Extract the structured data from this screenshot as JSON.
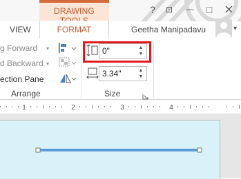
{
  "titlebar": {
    "contextual_tab": "DRAWING TOOLS",
    "help_glyph": "?",
    "restore_glyph": "⊡",
    "minimize_glyph": "—",
    "maximize_glyph": "□"
  },
  "tabs": {
    "view": "VIEW",
    "format": "FORMAT",
    "user_name": "Geetha Manipadavu",
    "account_dropdown": "▾"
  },
  "arrange": {
    "bring_forward": "g Forward",
    "send_backward": "d Backward",
    "selection_pane": "ection Pane",
    "group_label": "Arrange",
    "dropdown_caret": "▾"
  },
  "size": {
    "height_value": "0\"",
    "width_value": "3.34\"",
    "group_label": "Size",
    "up_glyph": "▲",
    "down_glyph": "▼"
  },
  "ruler": {
    "ticks": [
      "1",
      "2",
      "3",
      "4"
    ]
  },
  "colors": {
    "accent": "#c55a2b",
    "contextual_tab_bg": "#fbe5d6",
    "highlight": "#e0181f",
    "slide_bg": "#d9f2fa",
    "line_shape": "#5b9bd5"
  }
}
